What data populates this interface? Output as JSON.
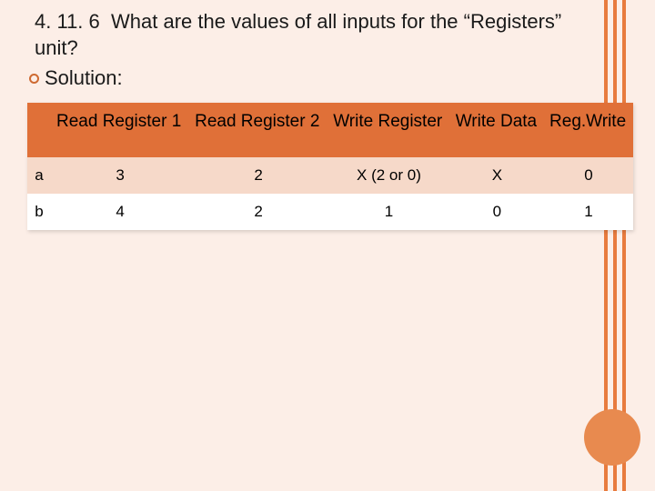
{
  "question": {
    "number": "4. 11. 6",
    "text_line1": "What are the values of all inputs for the “Registers”",
    "text_line2": "unit?",
    "solution_label": "Solution:"
  },
  "table": {
    "headers": [
      "",
      "Read Register 1",
      "Read Register 2",
      "Write Register",
      "Write Data",
      "Reg.Write"
    ],
    "rows": [
      {
        "label": "a",
        "cells": [
          "3",
          "2",
          "X (2 or 0)",
          "X",
          "0"
        ]
      },
      {
        "label": "b",
        "cells": [
          "4",
          "2",
          "1",
          "0",
          "1"
        ]
      }
    ]
  },
  "chart_data": {
    "type": "table",
    "title": "Values of all inputs for the Registers unit",
    "columns": [
      "Read Register 1",
      "Read Register 2",
      "Write Register",
      "Write Data",
      "Reg.Write"
    ],
    "rows": {
      "a": [
        "3",
        "2",
        "X (2 or 0)",
        "X",
        "0"
      ],
      "b": [
        "4",
        "2",
        "1",
        "0",
        "1"
      ]
    }
  }
}
